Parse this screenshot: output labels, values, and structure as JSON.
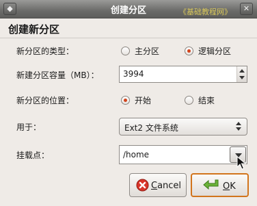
{
  "window": {
    "title": "创建分区",
    "watermark": "《基础教程网》",
    "menu_glyph": "◆",
    "close_glyph": "✕"
  },
  "dialog": {
    "heading": "创建新分区",
    "type_label": "新分区的类型：",
    "type_options": [
      {
        "label": "主分区",
        "selected": false
      },
      {
        "label": "逻辑分区",
        "selected": true
      }
    ],
    "size_label": "新建分区容量（MB）：",
    "size_value": "3994",
    "position_label": "新分区的位置：",
    "position_options": [
      {
        "label": "开始",
        "selected": true
      },
      {
        "label": "结束",
        "selected": false
      }
    ],
    "use_label": "用于：",
    "use_value": "Ext2 文件系统",
    "mount_label": "挂载点：",
    "mount_value": "/home",
    "cancel_label": "ancel",
    "cancel_mnemonic": "C",
    "ok_label": "K",
    "ok_mnemonic": "O"
  },
  "colors": {
    "accent": "#d2441c",
    "ok_border": "#d2741c",
    "cancel_icon": "#d9352a",
    "ok_icon": "#5aa02c"
  }
}
